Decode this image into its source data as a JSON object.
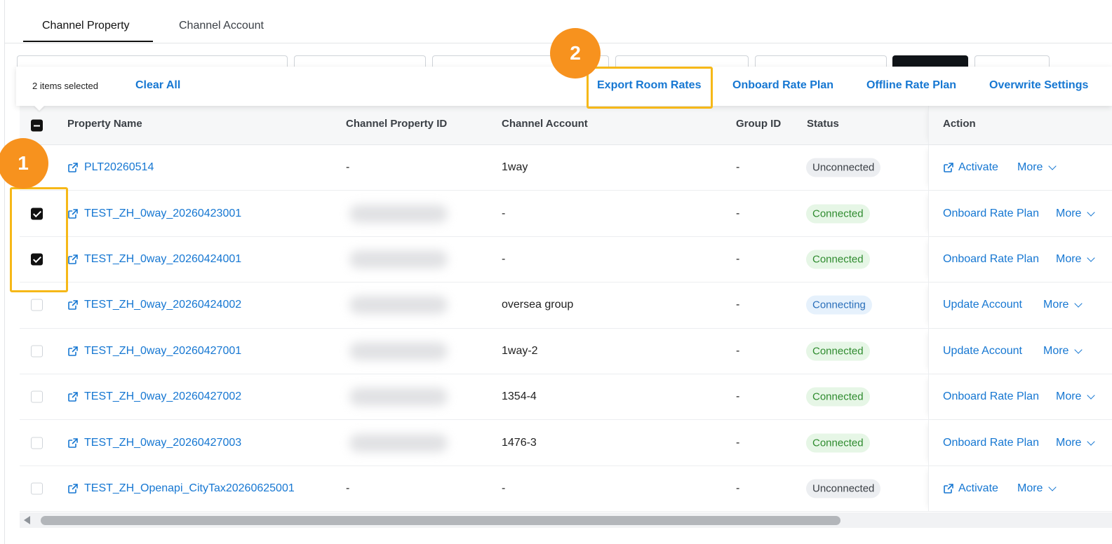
{
  "tabs": [
    {
      "label": "Channel Property",
      "active": true
    },
    {
      "label": "Channel Account",
      "active": false
    }
  ],
  "selection_bar": {
    "count_text": "2 items selected",
    "clear_all": "Clear All",
    "actions": [
      "Export Room Rates",
      "Onboard Rate Plan",
      "Offline Rate Plan",
      "Overwrite Settings"
    ]
  },
  "table": {
    "columns": [
      "Property Name",
      "Channel Property ID",
      "Channel Account",
      "Group ID",
      "Status",
      "Action"
    ],
    "rows": [
      {
        "name": "PLT20260514",
        "channel_property_id": "-",
        "channel_account": "1way",
        "group_id": "-",
        "status": "Unconnected",
        "action": "Activate",
        "more": "More",
        "checked": false
      },
      {
        "name": "TEST_ZH_0way_20260423001",
        "channel_property_id": "",
        "channel_account": "-",
        "group_id": "-",
        "status": "Connected",
        "action": "Onboard Rate Plan",
        "more": "More",
        "checked": true
      },
      {
        "name": "TEST_ZH_0way_20260424001",
        "channel_property_id": "",
        "channel_account": "-",
        "group_id": "-",
        "status": "Connected",
        "action": "Onboard Rate Plan",
        "more": "More",
        "checked": true
      },
      {
        "name": "TEST_ZH_0way_20260424002",
        "channel_property_id": "",
        "channel_account": "oversea group",
        "group_id": "-",
        "status": "Connecting",
        "action": "Update Account",
        "more": "More",
        "checked": false
      },
      {
        "name": "TEST_ZH_0way_20260427001",
        "channel_property_id": "",
        "channel_account": "1way-2",
        "group_id": "-",
        "status": "Connected",
        "action": "Update Account",
        "more": "More",
        "checked": false
      },
      {
        "name": "TEST_ZH_0way_20260427002",
        "channel_property_id": "",
        "channel_account": "1354-4",
        "group_id": "-",
        "status": "Connected",
        "action": "Onboard Rate Plan",
        "more": "More",
        "checked": false
      },
      {
        "name": "TEST_ZH_0way_20260427003",
        "channel_property_id": "",
        "channel_account": "1476-3",
        "group_id": "-",
        "status": "Connected",
        "action": "Onboard Rate Plan",
        "more": "More",
        "checked": false
      },
      {
        "name": "TEST_ZH_Openapi_CityTax20260625001",
        "channel_property_id": "-",
        "channel_account": "-",
        "group_id": "-",
        "status": "Unconnected",
        "action": "Activate",
        "more": "More",
        "checked": false
      }
    ]
  },
  "annotations": {
    "marker_1": "1",
    "marker_2": "2"
  },
  "colors": {
    "link": "#1677d2",
    "marker": "#f7921e",
    "highlight": "#f6b818",
    "connected": "#2e8b2e"
  }
}
